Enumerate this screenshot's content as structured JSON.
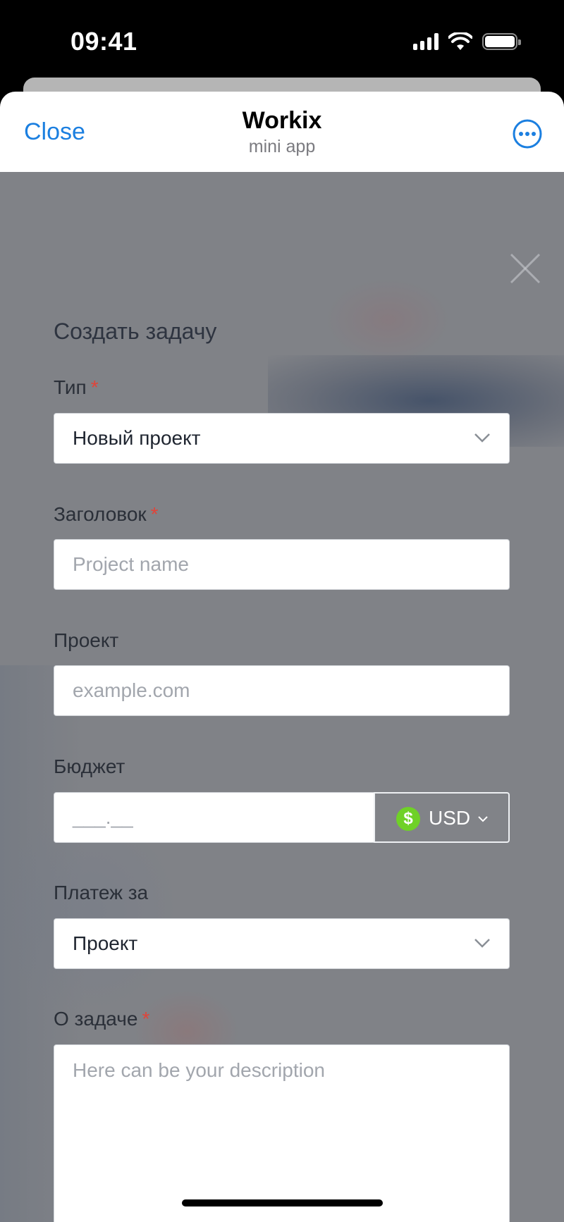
{
  "status_bar": {
    "time": "09:41"
  },
  "nav": {
    "close_label": "Close",
    "title": "Workix",
    "subtitle": "mini app"
  },
  "form": {
    "title": "Создать задачу",
    "type": {
      "label": "Тип",
      "required": "*",
      "value": "Новый проект"
    },
    "heading": {
      "label": "Заголовок",
      "required": "*",
      "placeholder": "Project name"
    },
    "project": {
      "label": "Проект",
      "placeholder": "example.com"
    },
    "budget": {
      "label": "Бюджет",
      "placeholder": "___.__",
      "currency_symbol": "$",
      "currency": "USD"
    },
    "payment": {
      "label": "Платеж за",
      "value": "Проект"
    },
    "about": {
      "label": "О задаче",
      "required": "*",
      "placeholder": "Here can be your description"
    }
  },
  "colors": {
    "accent": "#1b7fe0",
    "required": "#e0443a",
    "currency_badge": "#6fd127"
  }
}
